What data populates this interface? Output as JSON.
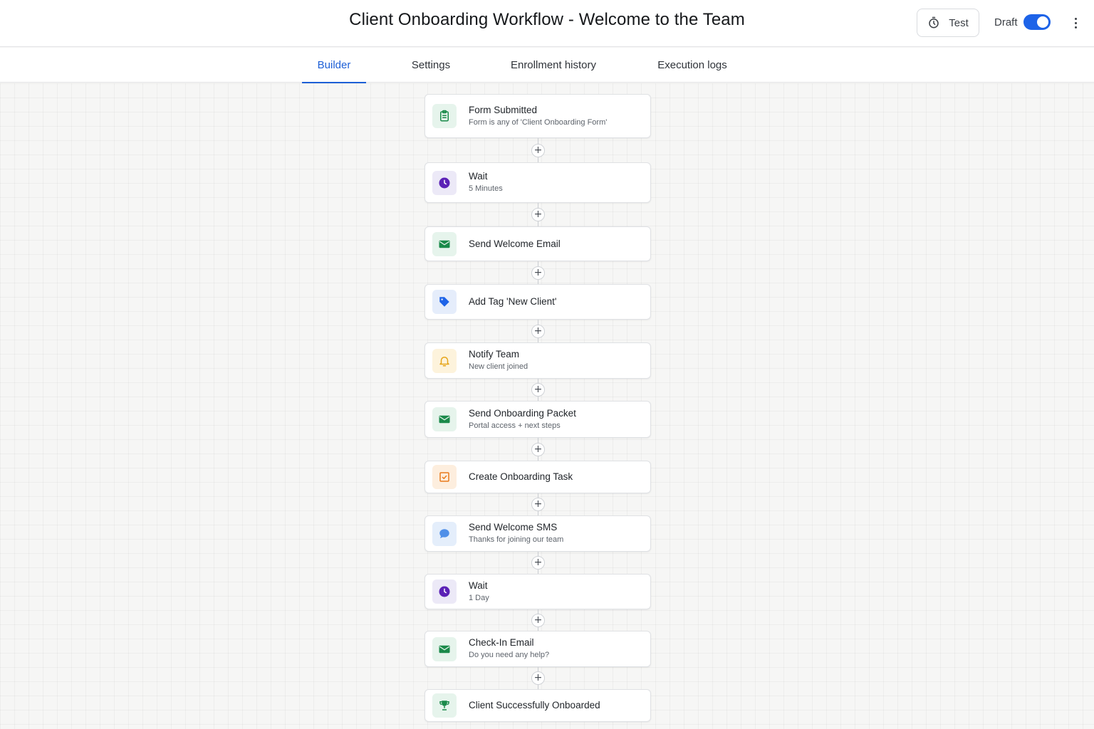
{
  "header": {
    "title": "Client Onboarding Workflow - Welcome to the Team",
    "test_label": "Test",
    "draft_label": "Draft",
    "draft_enabled": true
  },
  "tabs": [
    {
      "label": "Builder",
      "active": true
    },
    {
      "label": "Settings",
      "active": false
    },
    {
      "label": "Enrollment history",
      "active": false
    },
    {
      "label": "Execution logs",
      "active": false
    }
  ],
  "colors": {
    "accent": "#1d63e8",
    "green": "#1a8a4a",
    "purple": "#5b21b6",
    "blue": "#1d63e8",
    "yellow": "#e6a417",
    "orange": "#ea7a1b",
    "light_blue": "#4f8fe8"
  },
  "steps": [
    {
      "title": "Form Submitted",
      "subtitle": "Form is any of 'Client Onboarding Form'",
      "icon": "clipboard-icon",
      "color": "green"
    },
    {
      "title": "Wait",
      "subtitle": "5 Minutes",
      "icon": "clock-icon",
      "color": "purple"
    },
    {
      "title": "Send Welcome Email",
      "subtitle": "",
      "icon": "mail-icon",
      "color": "green"
    },
    {
      "title": "Add Tag 'New Client'",
      "subtitle": "",
      "icon": "tag-icon",
      "color": "blue"
    },
    {
      "title": "Notify Team",
      "subtitle": "New client joined",
      "icon": "bell-icon",
      "color": "yellow"
    },
    {
      "title": "Send Onboarding Packet",
      "subtitle": "Portal access + next steps",
      "icon": "mail-icon",
      "color": "green"
    },
    {
      "title": "Create Onboarding Task",
      "subtitle": "",
      "icon": "checkbox-icon",
      "color": "orange"
    },
    {
      "title": "Send Welcome SMS",
      "subtitle": "Thanks for joining our team",
      "icon": "chat-bubble-icon",
      "color": "light_blue"
    },
    {
      "title": "Wait",
      "subtitle": "1 Day",
      "icon": "clock-icon",
      "color": "purple"
    },
    {
      "title": "Check-In Email",
      "subtitle": "Do you need any help?",
      "icon": "mail-icon",
      "color": "green"
    },
    {
      "title": "Client Successfully Onboarded",
      "subtitle": "",
      "icon": "trophy-icon",
      "color": "green"
    }
  ],
  "add_step_symbol": "+"
}
